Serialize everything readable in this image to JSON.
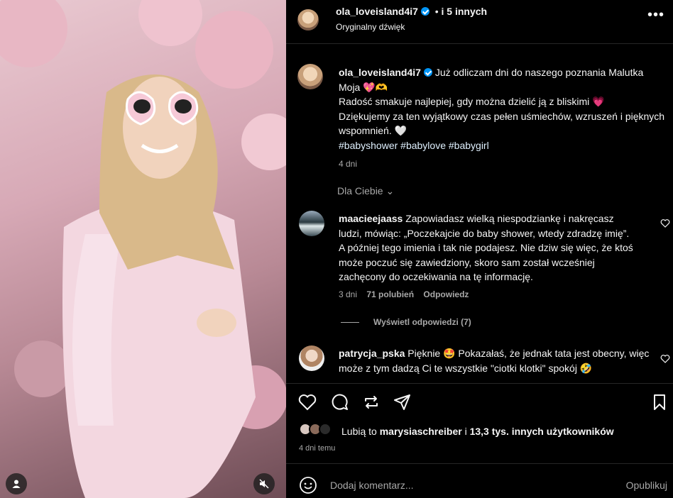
{
  "header": {
    "username": "ola_loveisland4i7",
    "collab": "i 5 innych",
    "audio": "Oryginalny dźwięk",
    "more_icon": "more-horizontal-icon"
  },
  "caption": {
    "username": "ola_loveisland4i7",
    "line1": "Już odliczam dni do naszego poznania Malutka Moja",
    "emoji1": "💖🫶",
    "line2": "Radość smakuje najlepiej, gdy można dzielić ją z bliskimi",
    "emoji2": "💗",
    "line3": "Dziękujemy za ten wyjątkowy czas pełen uśmiechów, wzruszeń i pięknych wspomnień.",
    "emoji3": "🤍",
    "hashtags": "#babyshower #babylove #babygirl",
    "time": "4 dni"
  },
  "for_you": "Dla Ciebie",
  "comments": [
    {
      "username": "maacieejaass",
      "text": "Zapowiadasz wielką niespodziankę i nakręcasz ludzi, mówiąc: „Poczekajcie do baby shower, wtedy zdradzę imię”. A później tego imienia i tak nie podajesz. Nie dziw się więc, że ktoś może poczuć się zawiedziony, skoro sam został wcześniej zachęcony do oczekiwania na tę informację.",
      "time": "3 dni",
      "likes": "71 polubień",
      "reply": "Odpowiedz",
      "view_replies": "Wyświetl odpowiedzi (7)"
    },
    {
      "username": "patrycja_pska",
      "text": "Pięknie 🤩 Pokazałaś, że jednak tata jest obecny, więc może z tym dadzą Ci te wszystkie \"ciotki klotki\" spokój 🤣"
    }
  ],
  "likes": {
    "prefix": "Lubią to",
    "user": "marysiaschreiber",
    "middle": "i",
    "others": "13,3 tys. innych użytkowników"
  },
  "posted_ago": "4 dni temu",
  "comment_box": {
    "placeholder": "Dodaj komentarz...",
    "publish": "Opublikuj"
  },
  "colors": {
    "accent": "#0095f6",
    "hashtag": "#e0f1ff",
    "muted": "#a8a8a8"
  }
}
